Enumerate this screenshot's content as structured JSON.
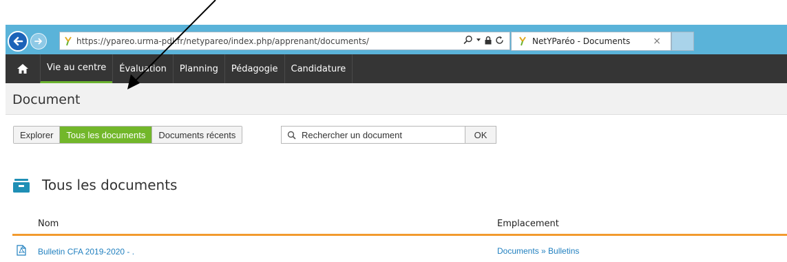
{
  "browser": {
    "url": "https://ypareo.urma-pdl.fr/netypareo/index.php/apprenant/documents/",
    "tab_title": "NetYParéo - Documents",
    "tab_close": "×"
  },
  "nav": {
    "items": [
      {
        "label": "Vie au centre",
        "active": true
      },
      {
        "label": "Évaluation"
      },
      {
        "label": "Planning"
      },
      {
        "label": "Pédagogie"
      },
      {
        "label": "Candidature"
      }
    ]
  },
  "page": {
    "title": "Document"
  },
  "toolbar": {
    "tabs": [
      {
        "label": "Explorer"
      },
      {
        "label": "Tous les documents",
        "active": true
      },
      {
        "label": "Documents récents"
      }
    ],
    "search_placeholder": "Rechercher un document",
    "ok_label": "OK"
  },
  "section": {
    "title": "Tous les documents"
  },
  "table": {
    "columns": [
      "Nom",
      "Emplacement"
    ],
    "rows": [
      {
        "name": "Bulletin CFA 2019-2020 - .",
        "location": "Documents » Bulletins"
      }
    ]
  },
  "colors": {
    "accent_green": "#72b72a",
    "nav_dark": "#353535",
    "chrome_blue": "#5ab3d9",
    "header_orange": "#f29a2e",
    "link_blue": "#1f7fbf"
  },
  "icons": {
    "home": "home-icon",
    "back": "back-arrow-icon",
    "forward": "forward-arrow-icon",
    "search": "search-icon",
    "lock": "lock-icon",
    "refresh": "refresh-icon",
    "section": "inbox-tray-icon",
    "pdf": "pdf-file-icon"
  }
}
